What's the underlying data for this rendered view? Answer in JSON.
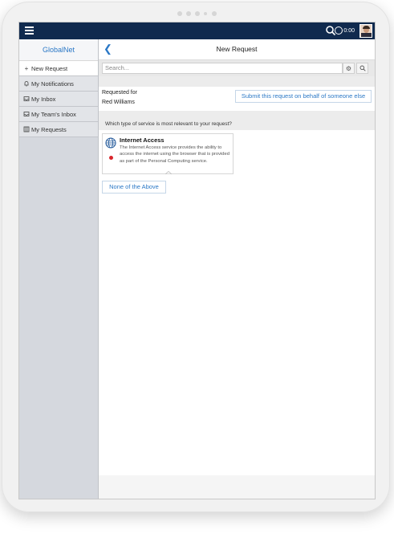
{
  "sidebar": {
    "title": "GlobalNet",
    "items": [
      {
        "label": "New Request",
        "icon": "plus-icon"
      },
      {
        "label": "My Notifications",
        "icon": "bell-icon"
      },
      {
        "label": "My Inbox",
        "icon": "inbox-icon"
      },
      {
        "label": "My Team's Inbox",
        "icon": "inbox-icon"
      },
      {
        "label": "My Requests",
        "icon": "list-icon"
      }
    ]
  },
  "topbar": {
    "timer": "0:00"
  },
  "header": {
    "title": "New Request",
    "back_icon": "chevron-left-icon"
  },
  "search": {
    "placeholder": "Search..."
  },
  "requested_for": {
    "label": "Requested for",
    "value": "Red Williams",
    "behalf_button": "Submit this request on behalf of someone else"
  },
  "question": "Which type of service is most relevant to your request?",
  "service_card": {
    "title": "Internet Access",
    "description": "The Internet Access service provides the ability to access the internet using the browser that is provided as part of the Personal Computing service."
  },
  "none_button": "None of the Above",
  "colors": {
    "topbar": "#102a4e",
    "accent": "#2b78c6",
    "status_dot": "#d9262c"
  }
}
